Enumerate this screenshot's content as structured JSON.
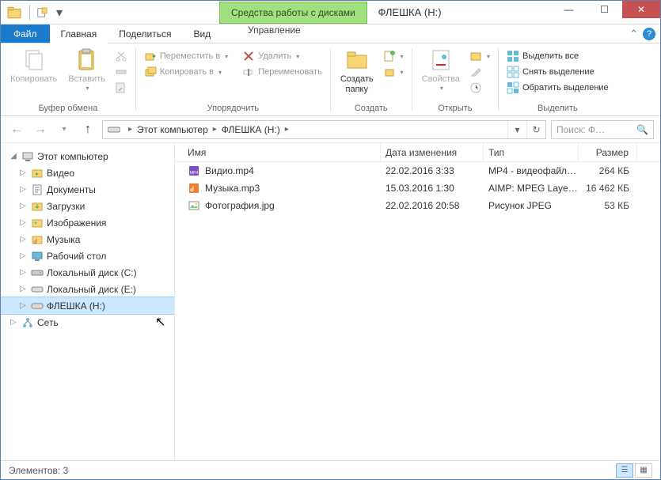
{
  "window": {
    "context_group": "Средства работы с дисками",
    "title": "ФЛЕШКА (H:)"
  },
  "tabs": {
    "file": "Файл",
    "home": "Главная",
    "share": "Поделиться",
    "view": "Вид",
    "manage": "Управление"
  },
  "ribbon": {
    "clipboard": {
      "copy": "Копировать",
      "paste": "Вставить",
      "label": "Буфер обмена"
    },
    "organize": {
      "move_to": "Переместить в",
      "copy_to": "Копировать в",
      "delete": "Удалить",
      "rename": "Переименовать",
      "label": "Упорядочить"
    },
    "new": {
      "new_folder": "Создать\nпапку",
      "label": "Создать"
    },
    "open": {
      "properties": "Свойства",
      "label": "Открыть"
    },
    "select": {
      "select_all": "Выделить все",
      "select_none": "Снять выделение",
      "invert": "Обратить выделение",
      "label": "Выделить"
    }
  },
  "breadcrumb": {
    "root": "Этот компьютер",
    "current": "ФЛЕШКА (H:)"
  },
  "search": {
    "placeholder": "Поиск: Ф…"
  },
  "tree": {
    "root": "Этот компьютер",
    "items": [
      {
        "label": "Видео",
        "icon": "videos"
      },
      {
        "label": "Документы",
        "icon": "docs"
      },
      {
        "label": "Загрузки",
        "icon": "downloads"
      },
      {
        "label": "Изображения",
        "icon": "pictures"
      },
      {
        "label": "Музыка",
        "icon": "music"
      },
      {
        "label": "Рабочий стол",
        "icon": "desktop"
      },
      {
        "label": "Локальный диск (C:)",
        "icon": "hdd"
      },
      {
        "label": "Локальный диск (E:)",
        "icon": "drive"
      },
      {
        "label": "ФЛЕШКА (H:)",
        "icon": "drive",
        "selected": true
      },
      {
        "label": "Сеть",
        "icon": "network",
        "level": 0
      }
    ]
  },
  "columns": {
    "name": "Имя",
    "date": "Дата изменения",
    "type": "Тип",
    "size": "Размер"
  },
  "files": [
    {
      "name": "Видио.mp4",
      "date": "22.02.2016 3:33",
      "type": "MP4 - видеофайл…",
      "size": "264 КБ",
      "icon": "mp4"
    },
    {
      "name": "Музыка.mp3",
      "date": "15.03.2016 1:30",
      "type": "AIMP: MPEG Laye…",
      "size": "16 462 КБ",
      "icon": "mp3"
    },
    {
      "name": "Фотография.jpg",
      "date": "22.02.2016 20:58",
      "type": "Рисунок JPEG",
      "size": "53 КБ",
      "icon": "img"
    }
  ],
  "status": {
    "count_label": "Элементов: 3"
  }
}
